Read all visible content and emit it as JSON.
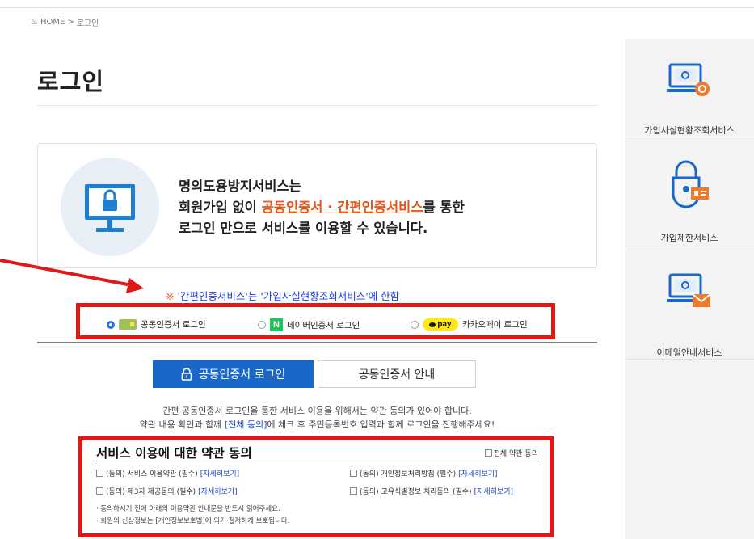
{
  "breadcrumb": {
    "home": "HOME",
    "sep": ">",
    "current": "로그인"
  },
  "page_title": "로그인",
  "sidebar": {
    "items": [
      {
        "label": "가입사실현황조회서비스",
        "icon": "monitor-search-icon"
      },
      {
        "label": "가입제한서비스",
        "icon": "padlock-card-icon"
      },
      {
        "label": "이메일안내서비스",
        "icon": "monitor-mail-icon"
      }
    ]
  },
  "notice": {
    "line1": "명의도용방지서비스는",
    "line2_pre": "회원가입 없이 ",
    "line2_hl": "공동인증서 · 간편인증서비스",
    "line2_post": "를 통한",
    "line3": "로그인 만으로 서비스를 이용할 수 있습니다."
  },
  "easy_note": {
    "mark": "※",
    "text": "'간편인증서비스'는 '가입사실현황조회서비스'에 한함"
  },
  "login_options": [
    {
      "label": "공동인증서 로그인",
      "selected": true
    },
    {
      "label": "네이버인증서 로그인",
      "selected": false
    },
    {
      "label": "카카오페이 로그인",
      "selected": false,
      "icon_text": "pay"
    }
  ],
  "naver_letter": "N",
  "tabs": {
    "login": "공동인증서 로그인",
    "guide": "공동인증서 안내"
  },
  "description": {
    "line1": "간편 공동인증서 로그인을 통한 서비스 이용을 위해서는 약관 동의가 있어야 합니다.",
    "line2_pre": "약관 내용 확인과 함께 ",
    "line2_kw": "[전체 동의]",
    "line2_post": "에 체크 후 주민등록번호 입력과 함께 로그인을 진행해주세요!"
  },
  "terms": {
    "title": "서비스 이용에 대한 약관 동의",
    "all_agree": "전체 약관 동의",
    "items": [
      {
        "label": "(동의) 서비스 이용약관 (필수)",
        "more": "[자세히보기]"
      },
      {
        "label": "(동의) 개인정보처리방침 (필수)",
        "more": "[자세히보기]"
      },
      {
        "label": "(동의) 제3자 제공동의 (필수)",
        "more": "[자세히보기]"
      },
      {
        "label": "(동의) 고유식별정보 처리동의 (필수)",
        "more": "[자세히보기]"
      }
    ],
    "notes": [
      "· 동의하시기 전에 아래의 이용약관 안내문을 반드시 읽어주세요.",
      "· 회원의 신상정보는 [개인정보보호법]에 의거 철저하게 보호됩니다."
    ]
  },
  "colors": {
    "accent": "#1867c9",
    "highlight": "#e8561d",
    "annotation_red": "#e01818",
    "link_blue": "#1d46c9"
  }
}
